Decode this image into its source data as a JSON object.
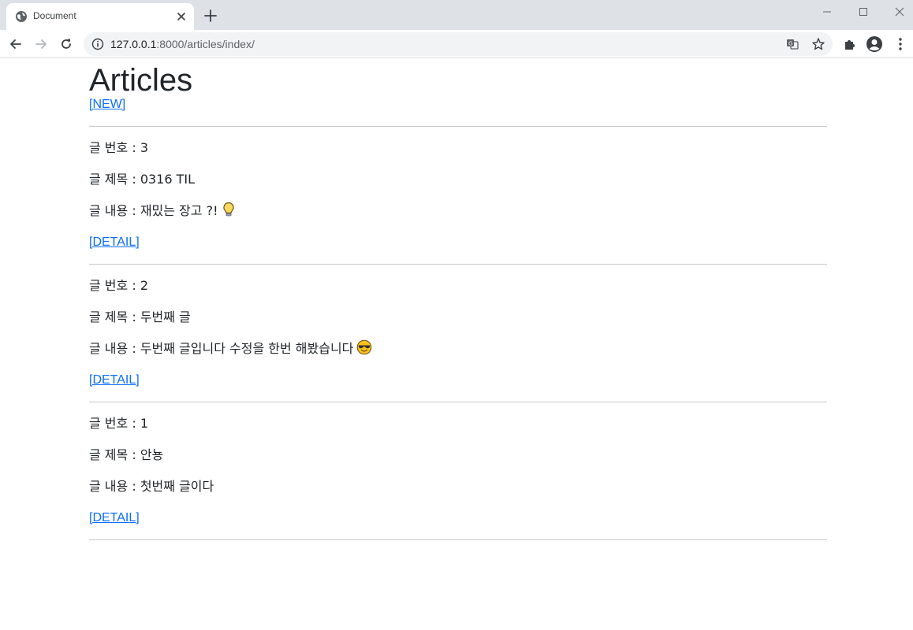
{
  "browser": {
    "tab_title": "Document",
    "url_host": "127.0.0.1",
    "url_path": ":8000/articles/index/"
  },
  "page": {
    "title": "Articles",
    "new_link": "[NEW]",
    "articles": [
      {
        "id_label": "글 번호 : ",
        "id": "3",
        "title_label": "글 제목 : ",
        "title": "0316 TIL",
        "content_label": "글 내용 : ",
        "content": "재밌는 장고 ?!",
        "emoji": "lightbulb-emoji",
        "detail_link": "[DETAIL]"
      },
      {
        "id_label": "글 번호 : ",
        "id": "2",
        "title_label": "글 제목 : ",
        "title": "두번째 글",
        "content_label": "글 내용 : ",
        "content": "두번째 글입니다 수정을 한번 해봤습니다",
        "emoji": "sunglasses-emoji",
        "detail_link": "[DETAIL]"
      },
      {
        "id_label": "글 번호 : ",
        "id": "1",
        "title_label": "글 제목 : ",
        "title": "안뇽",
        "content_label": "글 내용 : ",
        "content": "첫번째 글이다",
        "emoji": "",
        "detail_link": "[DETAIL]"
      }
    ]
  },
  "colors": {
    "link": "#0d6efd",
    "text": "#212529",
    "tabstrip": "#dee1e6",
    "omnibox": "#f1f3f4"
  }
}
